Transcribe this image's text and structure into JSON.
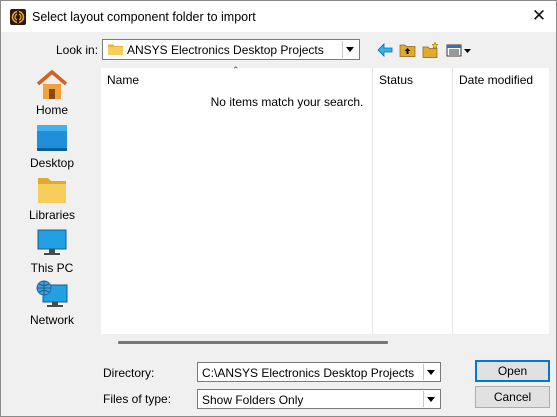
{
  "window": {
    "title": "Select layout component folder to import",
    "close_glyph": "✕",
    "icon": "ansys-app-icon"
  },
  "look_in": {
    "label": "Look in:",
    "value": "ANSYS Electronics Desktop Projects"
  },
  "toolbar": {
    "icons": [
      "back-arrow-icon",
      "up-folder-icon",
      "new-folder-icon",
      "view-menu-icon"
    ]
  },
  "places": [
    {
      "label": "Home",
      "icon": "home-icon"
    },
    {
      "label": "Desktop",
      "icon": "desktop-icon"
    },
    {
      "label": "Libraries",
      "icon": "libraries-icon"
    },
    {
      "label": "This PC",
      "icon": "this-pc-icon"
    },
    {
      "label": "Network",
      "icon": "network-icon"
    }
  ],
  "file_list": {
    "columns": [
      "Name",
      "Status",
      "Date modified"
    ],
    "empty_message": "No items match your search."
  },
  "directory": {
    "label": "Directory:",
    "value": "C:\\ANSYS Electronics Desktop Projects"
  },
  "files_of_type": {
    "label": "Files of type:",
    "value": "Show Folders Only"
  },
  "buttons": {
    "open": "Open",
    "cancel": "Cancel"
  },
  "colors": {
    "accent": "#0078d7",
    "folder": "#f5c542",
    "toolbar_arrow": "#1a9bd8"
  }
}
